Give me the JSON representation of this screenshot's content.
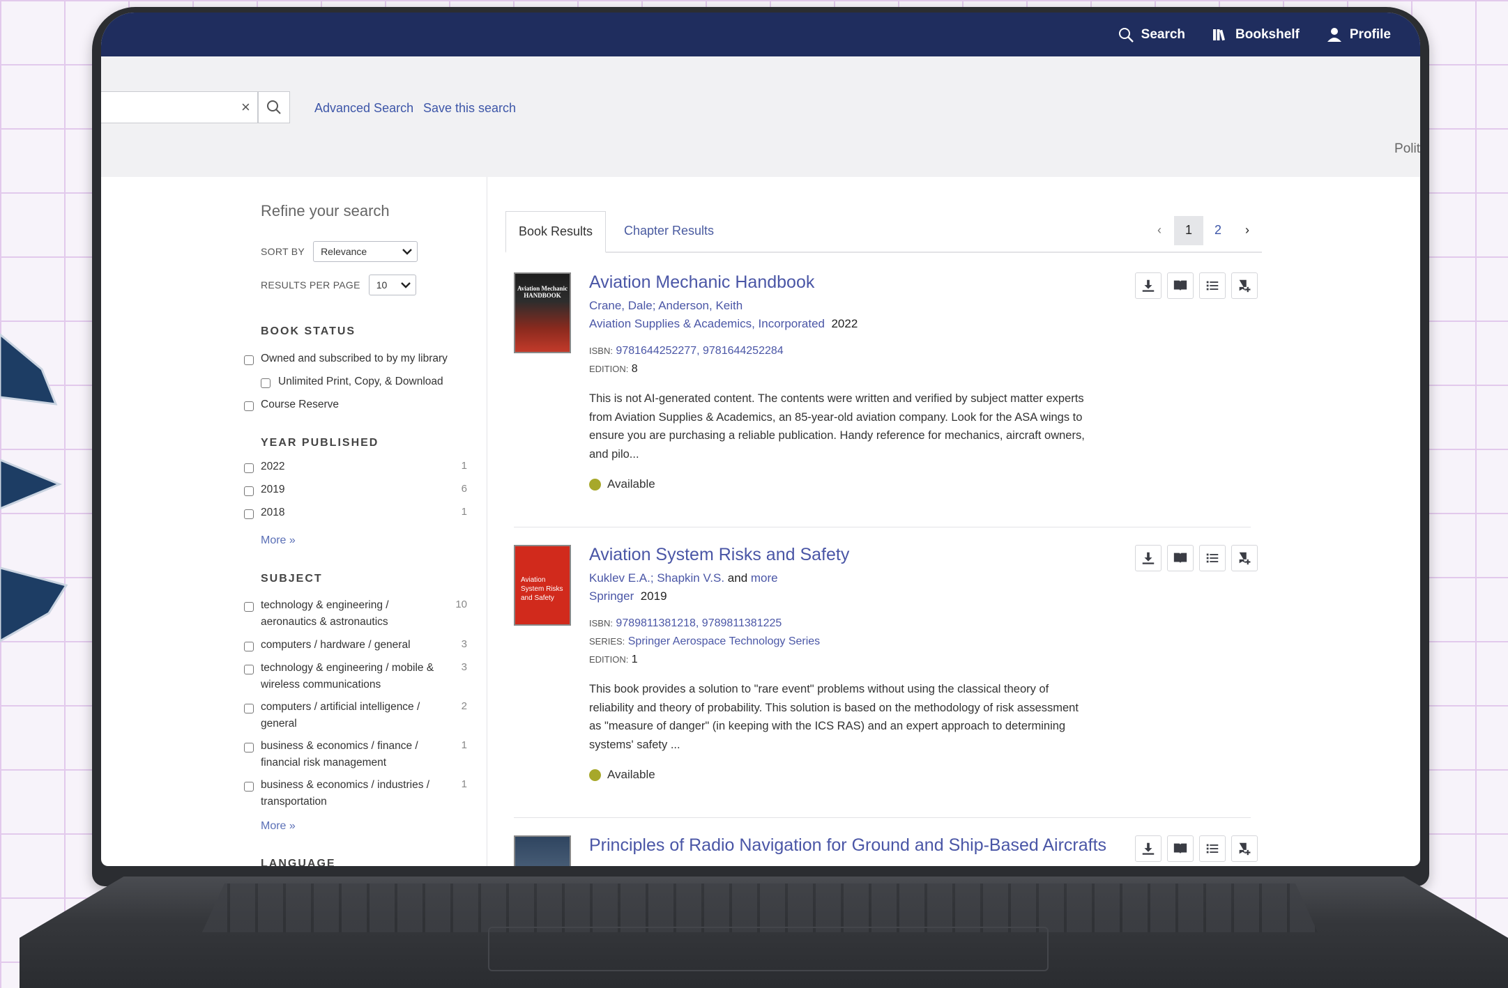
{
  "topnav": {
    "search_label": "Search",
    "bookshelf_label": "Bookshelf",
    "profile_label": "Profile"
  },
  "searchbar": {
    "query": "",
    "clear_symbol": "×",
    "advanced_label": "Advanced Search",
    "save_label": "Save this search",
    "right_cut_text": "Polit"
  },
  "sidebar": {
    "refine_title": "Refine your search",
    "sort_by_label": "SORT BY",
    "sort_by_value": "Relevance",
    "per_page_label": "RESULTS PER PAGE",
    "per_page_value": "10",
    "book_status_title": "BOOK STATUS",
    "book_status": [
      {
        "label": "Owned and subscribed to by my library"
      },
      {
        "label": "Unlimited Print, Copy, & Download"
      },
      {
        "label": "Course Reserve"
      }
    ],
    "year_title": "YEAR PUBLISHED",
    "years": [
      {
        "label": "2022",
        "count": "1"
      },
      {
        "label": "2019",
        "count": "6"
      },
      {
        "label": "2018",
        "count": "1"
      }
    ],
    "more_label": "More",
    "subject_title": "SUBJECT",
    "subjects": [
      {
        "line1": "technology & engineering /",
        "line2": "aeronautics & astronautics",
        "count": "10"
      },
      {
        "line1": "computers / hardware / general",
        "line2": "",
        "count": "3"
      },
      {
        "line1": "technology & engineering / mobile &",
        "line2": "wireless communications",
        "count": "3"
      },
      {
        "line1": "computers / artificial intelligence /",
        "line2": "general",
        "count": "2"
      },
      {
        "line1": "business & economics / finance /",
        "line2": "financial risk management",
        "count": "1"
      },
      {
        "line1": "business & economics / industries /",
        "line2": "transportation",
        "count": "1"
      }
    ],
    "language_title": "LANGUAGE"
  },
  "tabs": {
    "book_results": "Book Results",
    "chapter_results": "Chapter Results"
  },
  "pager": {
    "prev": "‹",
    "page1": "1",
    "page2": "2",
    "next": "›"
  },
  "results": [
    {
      "title": "Aviation Mechanic Handbook",
      "authors": "Crane, Dale; Anderson, Keith",
      "publisher": "Aviation Supplies & Academics, Incorporated",
      "year": "2022",
      "isbn_key": "ISBN:",
      "isbn": "9781644252277, 9781644252284",
      "edition_key": "EDITION:",
      "edition": "8",
      "description": "This is not AI-generated content. The contents were written and verified by subject matter experts from Aviation Supplies & Academics, an 85-year-old aviation company. Look for the ASA wings to ensure you are purchasing a reliable publication. Handy reference for mechanics, aircraft owners, and pilo...",
      "status": "Available",
      "cover_text": "Aviation Mechanic HANDBOOK"
    },
    {
      "title": "Aviation System Risks and Safety",
      "authors": "Kuklev E.A.; Shapkin V.S.",
      "authors_and": "and",
      "authors_more": "more",
      "publisher": "Springer",
      "year": "2019",
      "isbn_key": "ISBN:",
      "isbn": "9789811381218, 9789811381225",
      "series_key": "SERIES:",
      "series": "Springer Aerospace Technology Series",
      "edition_key": "EDITION:",
      "edition": "1",
      "description": "This book provides a solution to \"rare event\" problems without using the classical theory of reliability and theory of probability. This solution is based on the methodology of risk assessment as \"measure of danger\" (in keeping with the ICS RAS) and an expert approach to determining systems' safety ...",
      "status": "Available",
      "cover_text": "Aviation System Risks and Safety"
    },
    {
      "title": "Principles of Radio Navigation for Ground and Ship-Based Aircrafts"
    }
  ],
  "colors": {
    "nav_bg": "#1f2d5e",
    "link": "#4a56a6",
    "available": "#a7a82a"
  }
}
